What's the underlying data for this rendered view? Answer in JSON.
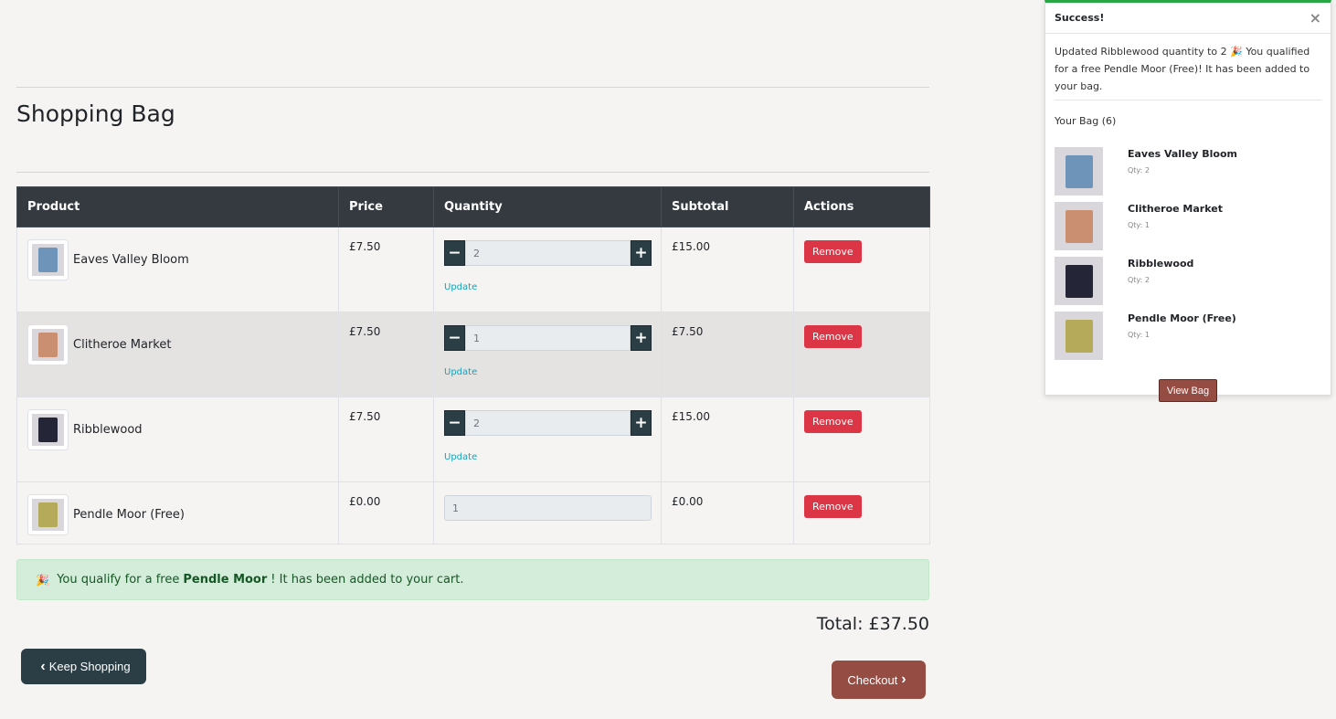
{
  "page": {
    "title": "Shopping Bag"
  },
  "table": {
    "headers": [
      "Product",
      "Price",
      "Quantity",
      "Subtotal",
      "Actions"
    ],
    "rows": [
      {
        "name": "Eaves Valley Bloom",
        "price": "£7.50",
        "qty": "2",
        "subtotal": "£15.00",
        "update": "Update",
        "remove": "Remove",
        "color": "#6e95b9",
        "has_stepper": true
      },
      {
        "name": "Clitheroe Market",
        "price": "£7.50",
        "qty": "1",
        "subtotal": "£7.50",
        "update": "Update",
        "remove": "Remove",
        "color": "#c98f70",
        "has_stepper": true
      },
      {
        "name": "Ribblewood",
        "price": "£7.50",
        "qty": "2",
        "subtotal": "£15.00",
        "update": "Update",
        "remove": "Remove",
        "color": "#252538",
        "has_stepper": true
      },
      {
        "name": "Pendle Moor (Free)",
        "price": "£0.00",
        "qty": "1",
        "subtotal": "£0.00",
        "remove": "Remove",
        "color": "#b5a95a",
        "has_stepper": false
      }
    ]
  },
  "alert": {
    "emoji": "🎉",
    "prefix": "You qualify for a free",
    "product": "Pendle Moor",
    "suffix": "! It has been added to your cart."
  },
  "total": {
    "label": "Total: £37.50"
  },
  "buttons": {
    "keep_shopping": "Keep Shopping",
    "checkout": "Checkout"
  },
  "toast": {
    "title": "Success!",
    "close": "×",
    "message": "Updated Ribblewood quantity to 2 🎉 You qualified for a free Pendle Moor (Free)! It has been added to your bag.",
    "bag_count": "Your Bag (6)",
    "items": [
      {
        "name": "Eaves Valley Bloom",
        "qty": "Qty: 2",
        "color": "#6e95b9"
      },
      {
        "name": "Clitheroe Market",
        "qty": "Qty: 1",
        "color": "#c98f70"
      },
      {
        "name": "Ribblewood",
        "qty": "Qty: 2",
        "color": "#252538"
      },
      {
        "name": "Pendle Moor (Free)",
        "qty": "Qty: 1",
        "color": "#b5a95a"
      }
    ],
    "view_bag": "View Bag"
  },
  "colors": {
    "accent": "#944c43",
    "dark": "#2c3e45",
    "danger": "#dc3545",
    "success": "#28a745"
  },
  "icons": {
    "minus": "minus-icon",
    "plus": "plus-icon",
    "chevron_left": "chevron-left-icon",
    "chevron_right": "chevron-right-icon",
    "close": "close-icon",
    "party": "party-popper-icon"
  }
}
